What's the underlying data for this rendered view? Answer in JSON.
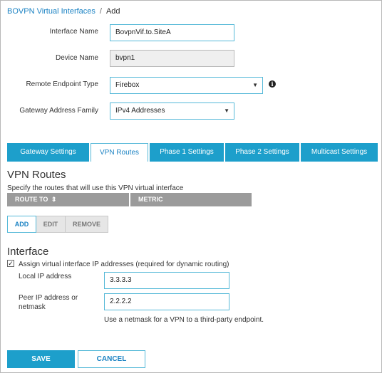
{
  "breadcrumb": {
    "parent": "BOVPN Virtual Interfaces",
    "separator": "/",
    "current": "Add"
  },
  "form": {
    "interface_name": {
      "label": "Interface Name",
      "value": "BovpnVif.to.SiteA"
    },
    "device_name": {
      "label": "Device Name",
      "value": "bvpn1"
    },
    "remote_endpoint_type": {
      "label": "Remote Endpoint Type",
      "value": "Firebox"
    },
    "gateway_address_family": {
      "label": "Gateway Address Family",
      "value": "IPv4 Addresses"
    }
  },
  "tabs": [
    {
      "label": "Gateway Settings",
      "active": false
    },
    {
      "label": "VPN Routes",
      "active": true
    },
    {
      "label": "Phase 1 Settings",
      "active": false
    },
    {
      "label": "Phase 2 Settings",
      "active": false
    },
    {
      "label": "Multicast Settings",
      "active": false
    }
  ],
  "vpn_routes": {
    "title": "VPN Routes",
    "description": "Specify the routes that will use this VPN virtual interface",
    "columns": [
      "ROUTE TO",
      "METRIC"
    ],
    "sort_icon": "sort-icon",
    "buttons": {
      "add": "ADD",
      "edit": "EDIT",
      "remove": "REMOVE"
    }
  },
  "interface": {
    "title": "Interface",
    "assign_checkbox": {
      "checked": true,
      "label": "Assign virtual interface IP addresses (required for dynamic routing)"
    },
    "local_ip": {
      "label": "Local IP address",
      "value": "3.3.3.3"
    },
    "peer_ip": {
      "label_line1": "Peer IP address or",
      "label_line2": "netmask",
      "value": "2.2.2.2"
    },
    "hint": "Use a netmask for a VPN to a third-party endpoint."
  },
  "actions": {
    "save": "SAVE",
    "cancel": "CANCEL"
  },
  "colors": {
    "accent": "#1d9fcb",
    "link": "#1a82c3",
    "input_border": "#56b9d8",
    "grid_header": "#9b9b9b"
  }
}
